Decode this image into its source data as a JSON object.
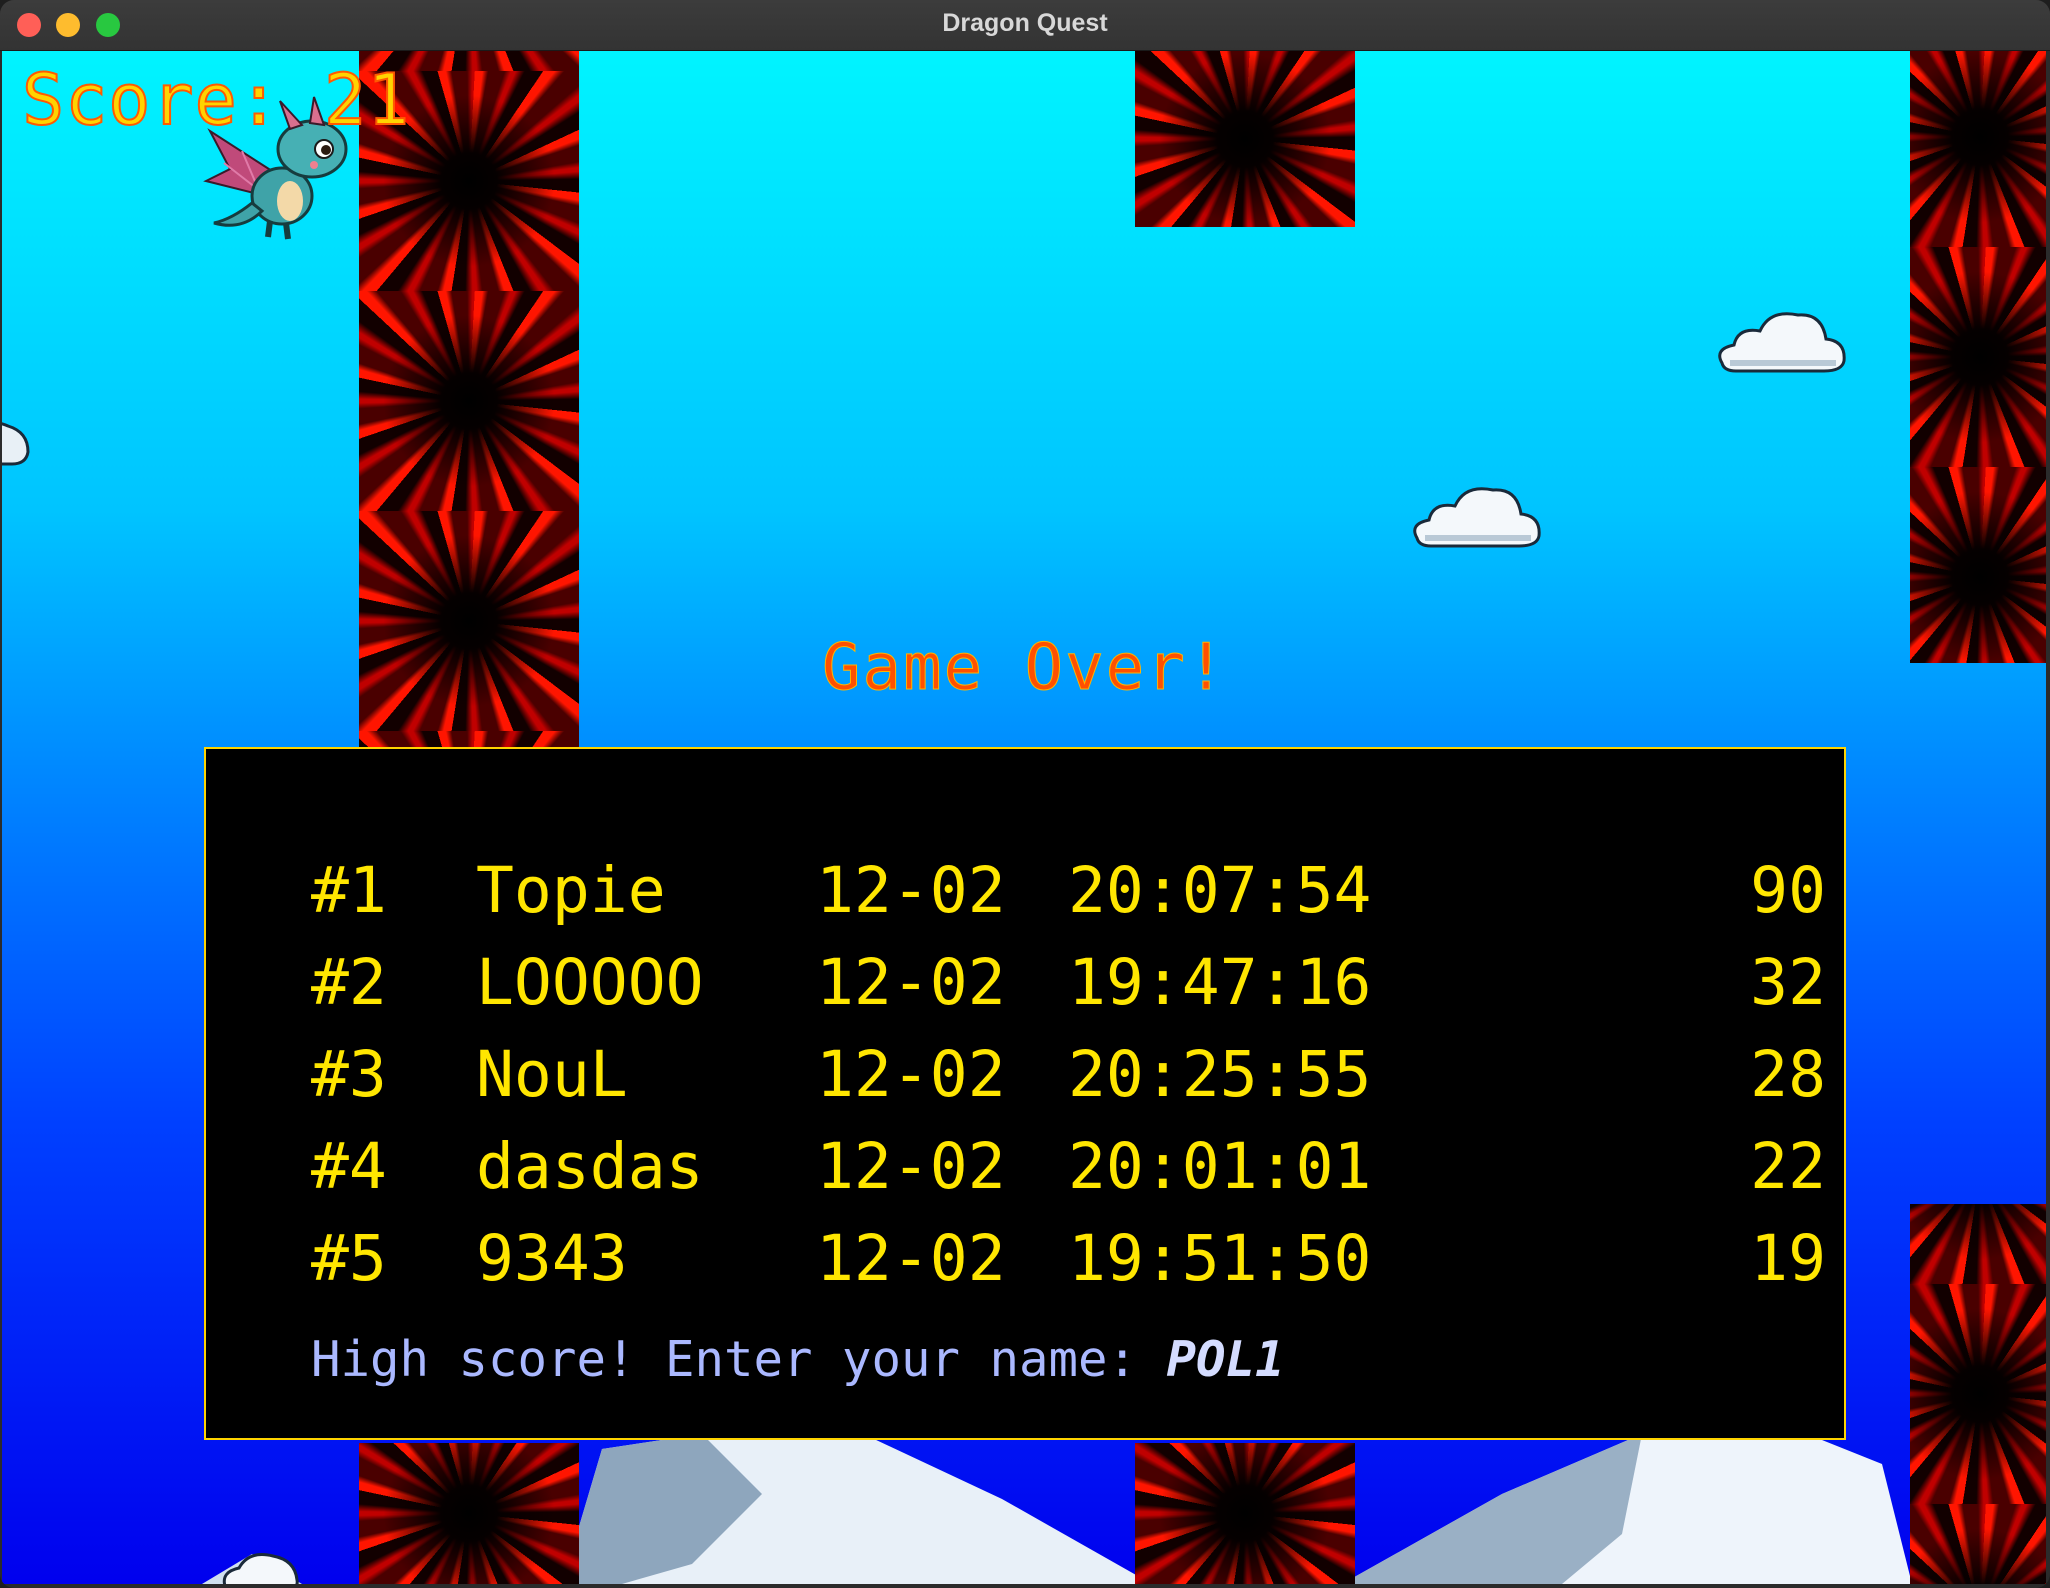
{
  "window": {
    "title": "Dragon Quest"
  },
  "hud": {
    "score_text": "Score: 21"
  },
  "game_over": {
    "text": "Game Over!"
  },
  "leaderboard": {
    "rows": [
      {
        "rank": "#1",
        "name": "Topie",
        "date": "12-02",
        "time": "20:07:54",
        "score": "90"
      },
      {
        "rank": "#2",
        "name": "LOOOOO",
        "date": "12-02",
        "time": "19:47:16",
        "score": "32"
      },
      {
        "rank": "#3",
        "name": "NouL",
        "date": "12-02",
        "time": "20:25:55",
        "score": "28"
      },
      {
        "rank": "#4",
        "name": "dasdas",
        "date": "12-02",
        "time": "20:01:01",
        "score": "22"
      },
      {
        "rank": "#5",
        "name": "9343",
        "date": "12-02",
        "time": "19:51:50",
        "score": "19"
      }
    ],
    "prompt_label": "High score! Enter your name: ",
    "name_input_value": "POL1"
  },
  "colors": {
    "score": "#ffd400",
    "game_over": "#ff5000",
    "table_text": "#ffe600",
    "prompt": "#aab8ff",
    "panel_border": "#ffd400"
  },
  "icons": {
    "player": "dragon-icon",
    "obstacle": "red-burst-pillar",
    "background": "cloud-icon"
  }
}
